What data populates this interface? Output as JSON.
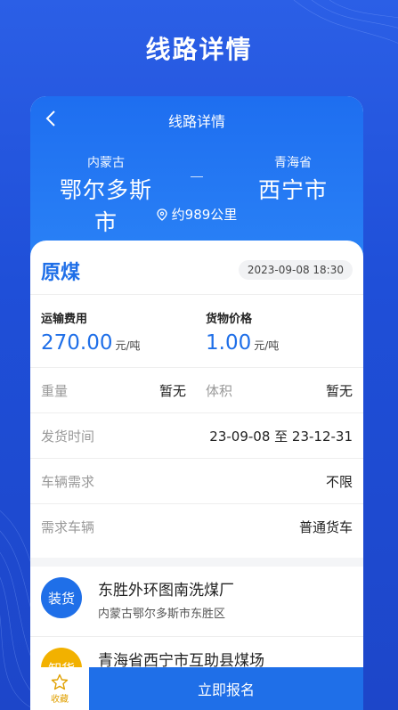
{
  "promo": {
    "title": "线路详情"
  },
  "nav": {
    "title": "线路详情"
  },
  "route": {
    "from_province": "内蒙古",
    "from_city": "鄂尔多斯市",
    "to_province": "青海省",
    "to_city": "西宁市",
    "distance": "约989公里"
  },
  "cargo": {
    "name": "原煤",
    "published": "2023-09-08 18:30",
    "freight_label": "运输费用",
    "freight_value": "270.00",
    "freight_unit": "元/吨",
    "goods_price_label": "货物价格",
    "goods_price_value": "1.00",
    "goods_price_unit": "元/吨",
    "weight_label": "重量",
    "weight_value": "暂无",
    "volume_label": "体积",
    "volume_value": "暂无",
    "ship_time_label": "发货时间",
    "ship_time_value": "23-09-08 至 23-12-31",
    "vehicle_req_label": "车辆需求",
    "vehicle_req_value": "不限",
    "vehicle_type_label": "需求车辆",
    "vehicle_type_value": "普通货车"
  },
  "addresses": [
    {
      "badge": "装货",
      "title": "东胜外环图南洗煤厂",
      "sub": "内蒙古鄂尔多斯市东胜区",
      "color": "#1f6fe8"
    },
    {
      "badge": "卸货",
      "title": "青海省西宁市互助县煤场",
      "sub": "",
      "color": "#f2b100"
    }
  ],
  "bottom": {
    "favorite_label": "收藏",
    "signup_label": "立即报名"
  },
  "colors": {
    "primary": "#1f6fe8",
    "accent": "#f2b100",
    "background": "#2355e0"
  }
}
